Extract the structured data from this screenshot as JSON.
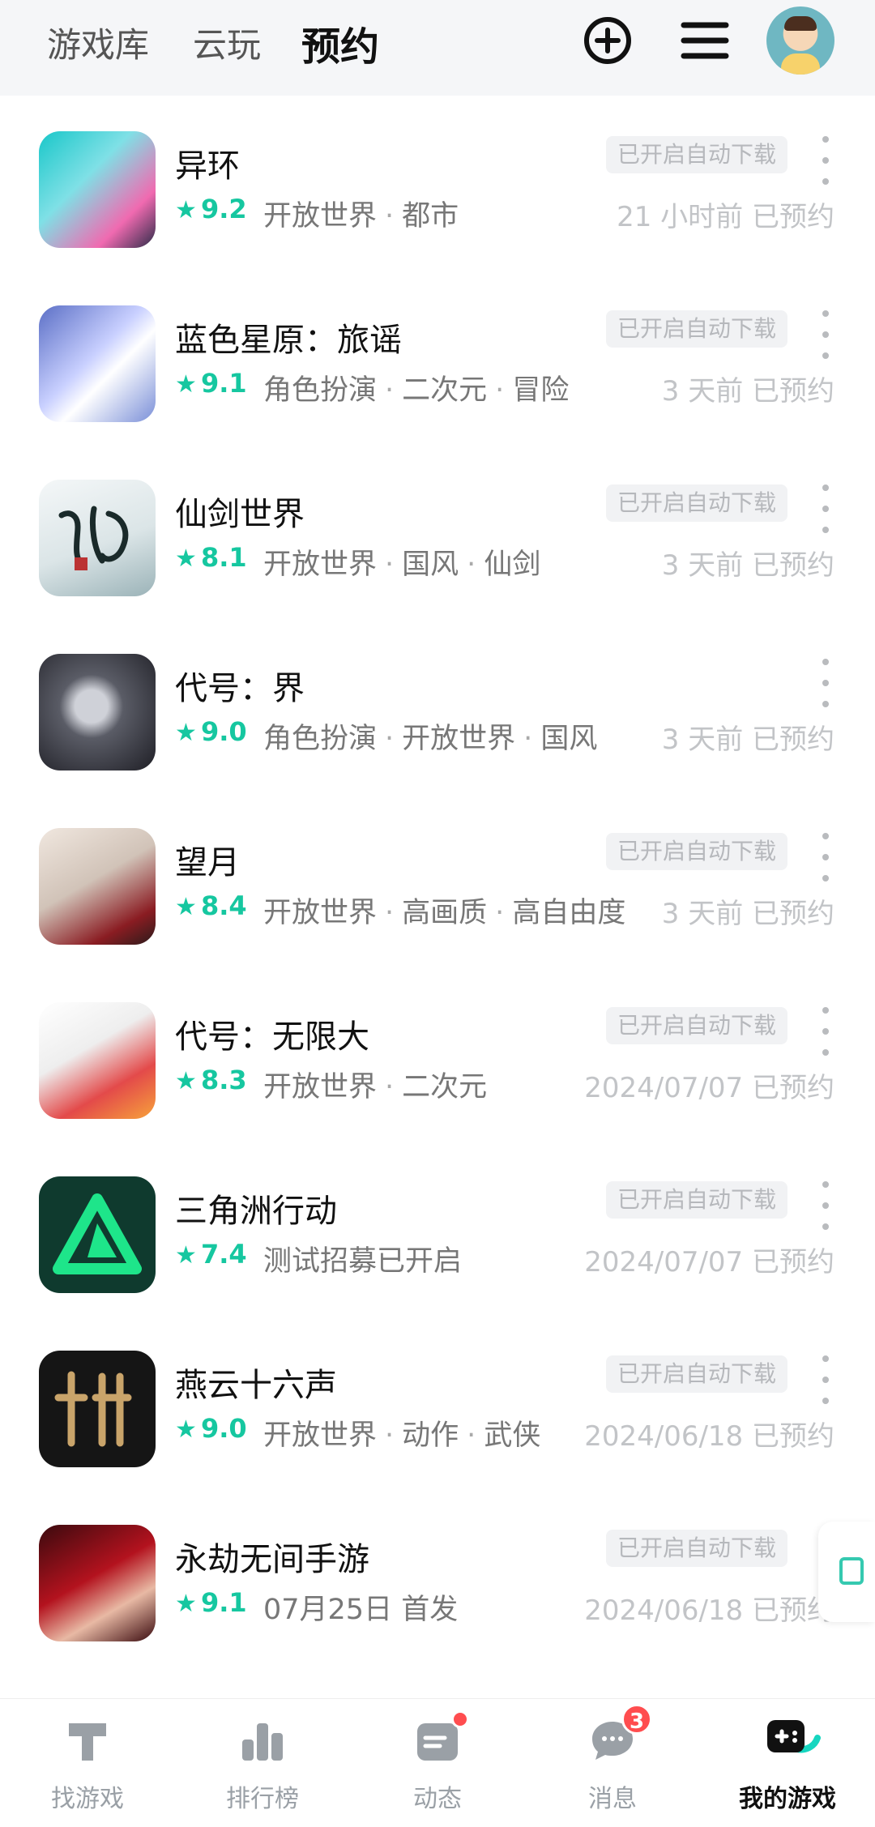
{
  "header": {
    "tabs": [
      {
        "label": "游戏库"
      },
      {
        "label": "云玩"
      },
      {
        "label": "预约"
      }
    ]
  },
  "games": [
    {
      "name": "异环",
      "rating": "9.2",
      "tags": [
        "开放世界",
        "都市"
      ],
      "badge": "已开启自动下载",
      "reserved": "21 小时前 已预约",
      "icon_colors": [
        "#19c7c9",
        "#f06ab0"
      ],
      "has_badge": true
    },
    {
      "name": "蓝色星原：旅谣",
      "rating": "9.1",
      "tags": [
        "角色扮演",
        "二次元",
        "冒险"
      ],
      "badge": "已开启自动下载",
      "reserved": "3 天前 已预约",
      "icon_colors": [
        "#7a8fd8",
        "#e6e9ff"
      ],
      "has_badge": true
    },
    {
      "name": "仙剑世界",
      "rating": "8.1",
      "tags": [
        "开放世界",
        "国风",
        "仙剑"
      ],
      "badge": "已开启自动下载",
      "reserved": "3 天前 已预约",
      "icon_colors": [
        "#e9eef2",
        "#9bb3b8"
      ],
      "has_badge": true
    },
    {
      "name": "代号：界",
      "rating": "9.0",
      "tags": [
        "角色扮演",
        "开放世界",
        "国风"
      ],
      "badge": "",
      "reserved": "3 天前 已预约",
      "icon_colors": [
        "#2b2b34",
        "#8b8e9e"
      ],
      "has_badge": false
    },
    {
      "name": "望月",
      "rating": "8.4",
      "tags": [
        "开放世界",
        "高画质",
        "高自由度"
      ],
      "badge": "已开启自动下载",
      "reserved": "3 天前 已预约",
      "icon_colors": [
        "#d1c3b8",
        "#8a1c22"
      ],
      "has_badge": true
    },
    {
      "name": "代号：无限大",
      "rating": "8.3",
      "tags": [
        "开放世界",
        "二次元"
      ],
      "badge": "已开启自动下载",
      "reserved": "2024/07/07 已预约",
      "icon_colors": [
        "#f2f2f2",
        "#e34a4a"
      ],
      "has_badge": true
    },
    {
      "name": "三角洲行动",
      "rating": "7.4",
      "tags": [
        "测试招募已开启"
      ],
      "badge": "已开启自动下载",
      "reserved": "2024/07/07 已预约",
      "icon_colors": [
        "#0f3a2e",
        "#1ee58a"
      ],
      "has_badge": true
    },
    {
      "name": "燕云十六声",
      "rating": "9.0",
      "tags": [
        "开放世界",
        "动作",
        "武侠"
      ],
      "badge": "已开启自动下载",
      "reserved": "2024/06/18 已预约",
      "icon_colors": [
        "#1a1a1a",
        "#c9a46a"
      ],
      "has_badge": true
    },
    {
      "name": "永劫无间手游",
      "rating": "9.1",
      "tags": [
        "07月25日 首发"
      ],
      "badge": "已开启自动下载",
      "reserved": "2024/06/18 已预约",
      "icon_colors": [
        "#b3121e",
        "#3a0a0e"
      ],
      "has_badge": true
    }
  ],
  "bottom_nav": [
    {
      "label": "找游戏",
      "icon": "find-game-icon"
    },
    {
      "label": "排行榜",
      "icon": "ranking-icon"
    },
    {
      "label": "动态",
      "icon": "feed-icon"
    },
    {
      "label": "消息",
      "icon": "message-icon",
      "badge": "3"
    },
    {
      "label": "我的游戏",
      "icon": "my-games-icon"
    }
  ],
  "colors": {
    "accent": "#16c7a0",
    "badge_red": "#ff4d4f"
  }
}
